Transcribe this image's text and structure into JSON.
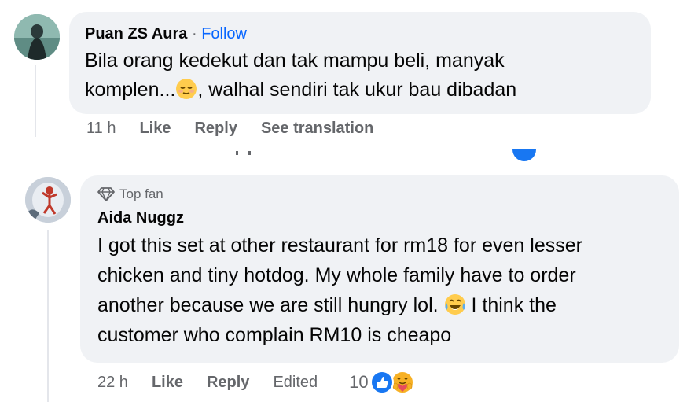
{
  "comment1": {
    "author": "Puan ZS Aura",
    "separator": "·",
    "follow_label": "Follow",
    "text_line1": "Bila orang kedekut dan tak mampu beli, manyak",
    "text_line2_before": "komplen...",
    "emoji": "relieved-face",
    "text_line2_after": ", walhal sendiri tak ukur bau dibadan",
    "time": "11 h",
    "like_label": "Like",
    "reply_label": "Reply",
    "translate_label": "See translation"
  },
  "comment2": {
    "badge": "Top fan",
    "badge_icon": "diamond-icon",
    "author": "Aida Nuggz",
    "text_line1": "I got this set at other restaurant for rm18 for even lesser",
    "text_line2": "chicken and tiny hotdog. My whole family have to order",
    "text_line3_before": "another because we are still hungry lol.",
    "emoji": "tears-of-joy",
    "text_line3_after": "I think the",
    "text_line4": "customer who complain RM10 is cheapo",
    "time": "22 h",
    "like_label": "Like",
    "reply_label": "Reply",
    "edited_label": "Edited",
    "reaction_count": "10",
    "reactions": [
      "like",
      "care"
    ]
  },
  "colors": {
    "bubble": "#f0f2f5",
    "link": "#0866ff",
    "meta": "#65676b",
    "text": "#050505"
  }
}
